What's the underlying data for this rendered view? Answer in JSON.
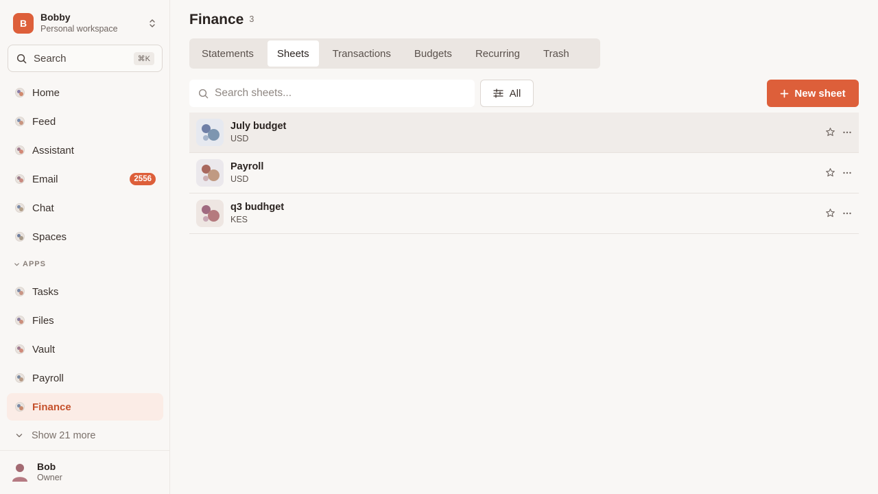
{
  "workspace": {
    "initial": "B",
    "name": "Bobby",
    "subtitle": "Personal workspace"
  },
  "search": {
    "label": "Search",
    "shortcut": "⌘K"
  },
  "nav": {
    "home": "Home",
    "feed": "Feed",
    "assistant": "Assistant",
    "email": "Email",
    "email_badge": "2556",
    "chat": "Chat",
    "spaces": "Spaces"
  },
  "apps": {
    "heading": "APPS",
    "tasks": "Tasks",
    "files": "Files",
    "vault": "Vault",
    "payroll": "Payroll",
    "finance": "Finance"
  },
  "show_more": "Show 21 more",
  "user": {
    "name": "Bob",
    "role": "Owner"
  },
  "page": {
    "title": "Finance",
    "count": "3"
  },
  "tabs": [
    "Statements",
    "Sheets",
    "Transactions",
    "Budgets",
    "Recurring",
    "Trash"
  ],
  "active_tab": "Sheets",
  "sheet_search": {
    "placeholder": "Search sheets..."
  },
  "filter": {
    "label": "All"
  },
  "new_sheet": {
    "label": "New sheet"
  },
  "sheets": [
    {
      "name": "July budget",
      "currency": "USD"
    },
    {
      "name": "Payroll",
      "currency": "USD"
    },
    {
      "name": "q3 budhget",
      "currency": "KES"
    }
  ],
  "colors": {
    "accent": "#dd5f3a",
    "active_bg": "#fbece6",
    "active_text": "#c5512c"
  }
}
